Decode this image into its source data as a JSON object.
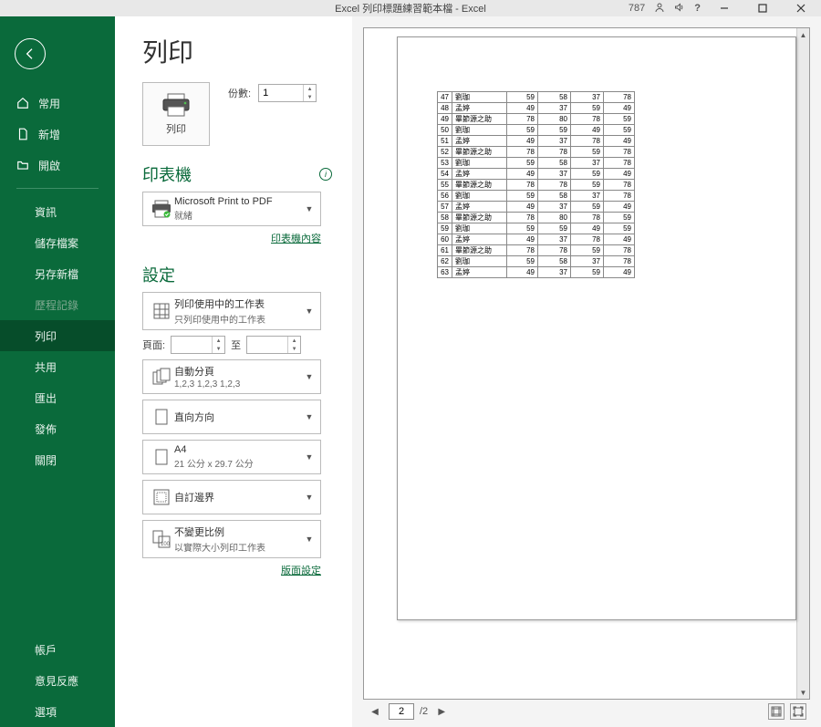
{
  "titlebar": {
    "title": "Excel 列印標題練習範本檔 - Excel",
    "count": "787"
  },
  "sidebar": {
    "home": "常用",
    "new": "新增",
    "open": "開啟",
    "info": "資訊",
    "save": "儲存檔案",
    "saveas": "另存新檔",
    "history": "歷程記錄",
    "print": "列印",
    "share": "共用",
    "export": "匯出",
    "publish": "發佈",
    "close": "關閉",
    "account": "帳戶",
    "feedback": "意見反應",
    "options": "選項"
  },
  "page_title": "列印",
  "print_btn": "列印",
  "copies": {
    "label": "份數:",
    "value": "1"
  },
  "printer": {
    "section": "印表機",
    "name": "Microsoft Print to PDF",
    "status": "就緒",
    "props_link": "印表機內容"
  },
  "settings": {
    "section": "設定",
    "sheets": {
      "main": "列印使用中的工作表",
      "sub": "只列印使用中的工作表"
    },
    "pages": {
      "label": "頁面:",
      "to": "至"
    },
    "collate": {
      "main": "自動分頁",
      "sub": "1,2,3   1,2,3   1,2,3"
    },
    "orientation": {
      "main": "直向方向"
    },
    "paper": {
      "main": "A4",
      "sub": "21 公分 x 29.7 公分"
    },
    "margins": {
      "main": "自訂邊界"
    },
    "scaling": {
      "main": "不變更比例",
      "sub": "以實際大小列印工作表"
    },
    "page_setup_link": "版面設定"
  },
  "preview": {
    "current_page": "2",
    "total_pages": "/2",
    "rows": [
      [
        47,
        "劉珈",
        59,
        58,
        37,
        78
      ],
      [
        48,
        "孟婷",
        49,
        37,
        59,
        49
      ],
      [
        49,
        "畢節源之助",
        78,
        80,
        78,
        59
      ],
      [
        50,
        "劉珈",
        59,
        59,
        49,
        59
      ],
      [
        51,
        "孟婷",
        49,
        37,
        78,
        49
      ],
      [
        52,
        "畢節源之助",
        78,
        78,
        59,
        78
      ],
      [
        53,
        "劉珈",
        59,
        58,
        37,
        78
      ],
      [
        54,
        "孟婷",
        49,
        37,
        59,
        49
      ],
      [
        55,
        "畢節源之助",
        78,
        78,
        59,
        78
      ],
      [
        56,
        "劉珈",
        59,
        58,
        37,
        78
      ],
      [
        57,
        "孟婷",
        49,
        37,
        59,
        49
      ],
      [
        58,
        "畢節源之助",
        78,
        80,
        78,
        59
      ],
      [
        59,
        "劉珈",
        59,
        59,
        49,
        59
      ],
      [
        60,
        "孟婷",
        49,
        37,
        78,
        49
      ],
      [
        61,
        "畢節源之助",
        78,
        78,
        59,
        78
      ],
      [
        62,
        "劉珈",
        59,
        58,
        37,
        78
      ],
      [
        63,
        "孟婷",
        49,
        37,
        59,
        49
      ]
    ]
  }
}
